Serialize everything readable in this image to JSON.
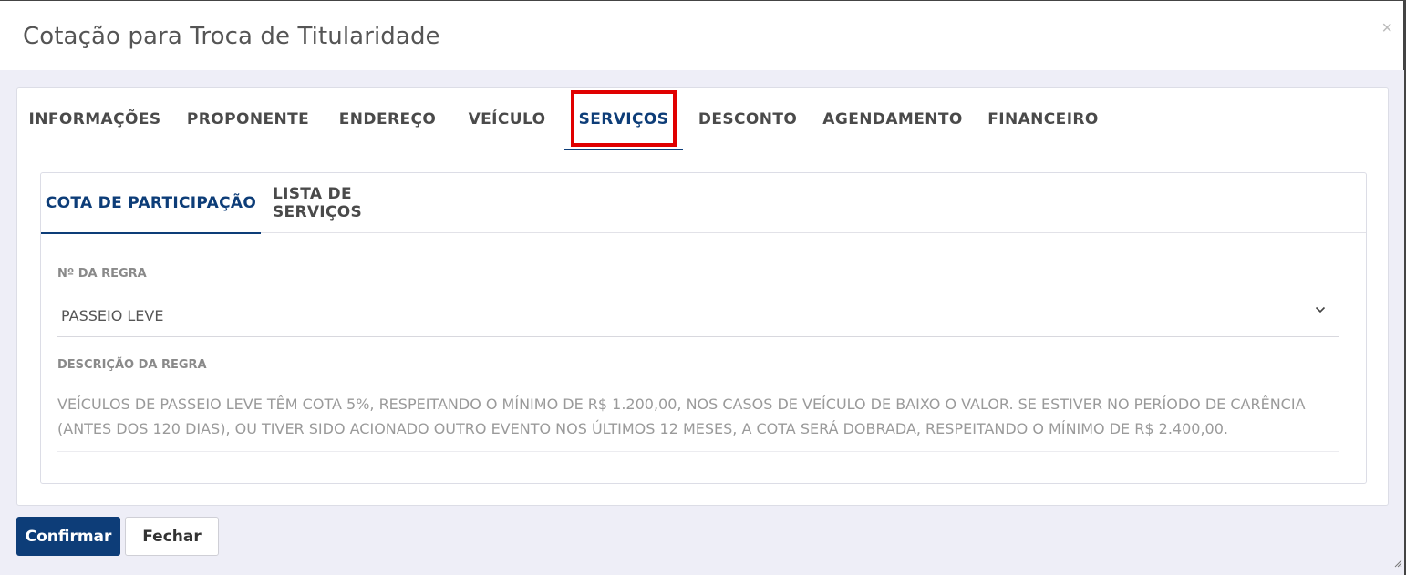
{
  "modal": {
    "title": "Cotação para Troca de Titularidade",
    "close_label": "×"
  },
  "tabs": [
    {
      "label": "INFORMAÇÕES"
    },
    {
      "label": "PROPONENTE"
    },
    {
      "label": "ENDEREÇO"
    },
    {
      "label": "VEÍCULO"
    },
    {
      "label": "SERVIÇOS",
      "active": true
    },
    {
      "label": "DESCONTO"
    },
    {
      "label": "AGENDAMENTO"
    },
    {
      "label": "FINANCEIRO"
    }
  ],
  "subtabs": [
    {
      "label": "COTA DE PARTICIPAÇÃO",
      "active": true
    },
    {
      "label": "LISTA DE SERVIÇOS"
    }
  ],
  "form": {
    "rule_label": "Nº DA REGRA",
    "rule_value": "PASSEIO LEVE",
    "desc_label": "DESCRIÇÃO DA REGRA",
    "desc_value": "VEÍCULOS DE PASSEIO LEVE TÊM COTA 5%, RESPEITANDO O MÍNIMO DE R$ 1.200,00, NOS CASOS DE VEÍCULO DE BAIXO O VALOR. SE ESTIVER NO PERÍODO DE CARÊNCIA (ANTES DOS 120 DIAS), OU TIVER SIDO ACIONADO OUTRO EVENTO NOS ÚLTIMOS 12 MESES, A COTA SERÁ DOBRADA, RESPEITANDO O MÍNIMO DE R$ 2.400,00."
  },
  "buttons": {
    "confirm": "Confirmar",
    "close": "Fechar"
  },
  "colors": {
    "primary": "#0d3d78",
    "highlight": "#e00000",
    "background": "#eeeef7"
  }
}
